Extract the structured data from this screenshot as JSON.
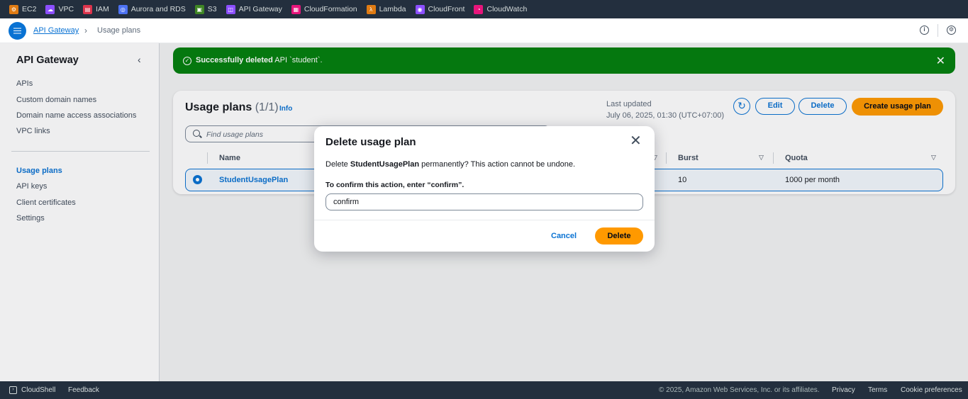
{
  "services": [
    {
      "label": "EC2",
      "icon": "ec2-icon",
      "color": "#e07b13"
    },
    {
      "label": "VPC",
      "icon": "vpc-icon",
      "color": "#8c4fff"
    },
    {
      "label": "IAM",
      "icon": "iam-icon",
      "color": "#dd344c"
    },
    {
      "label": "Aurora and RDS",
      "icon": "rds-icon",
      "color": "#4d72f3"
    },
    {
      "label": "S3",
      "icon": "s3-icon",
      "color": "#3f8624"
    },
    {
      "label": "API Gateway",
      "icon": "api-gateway-icon",
      "color": "#8c4fff"
    },
    {
      "label": "CloudFormation",
      "icon": "cloudformation-icon",
      "color": "#e7157b"
    },
    {
      "label": "Lambda",
      "icon": "lambda-icon",
      "color": "#e07b13"
    },
    {
      "label": "CloudFront",
      "icon": "cloudfront-icon",
      "color": "#8c4fff"
    },
    {
      "label": "CloudWatch",
      "icon": "cloudwatch-icon",
      "color": "#e7157b"
    }
  ],
  "breadcrumb": {
    "root": "API Gateway",
    "current": "Usage plans"
  },
  "sidebar": {
    "title": "API Gateway",
    "items_top": [
      "APIs",
      "Custom domain names",
      "Domain name access associations",
      "VPC links"
    ],
    "items_bottom": [
      "Usage plans",
      "API keys",
      "Client certificates",
      "Settings"
    ],
    "active": "Usage plans"
  },
  "flash": {
    "bold": "Successfully deleted",
    "rest": "API `student`."
  },
  "usage_plans": {
    "title": "Usage plans",
    "count": "(1/1)",
    "info": "Info",
    "last_updated_label": "Last updated",
    "last_updated_value": "July 06, 2025, 01:30 (UTC+07:00)",
    "edit": "Edit",
    "delete": "Delete",
    "create": "Create usage plan",
    "search_placeholder": "Find usage plans",
    "columns": {
      "name": "Name",
      "burst": "Burst",
      "quota": "Quota"
    },
    "row": {
      "name": "StudentUsagePlan",
      "burst": "10",
      "quota": "1000 per month"
    }
  },
  "modal": {
    "title": "Delete usage plan",
    "text_prefix": "Delete",
    "text_name": "StudentUsagePlan",
    "text_suffix": "permanently? This action cannot be undone.",
    "confirm_label": "To confirm this action, enter “confirm”.",
    "confirm_value": "confirm",
    "cancel": "Cancel",
    "delete": "Delete"
  },
  "footer": {
    "cloudshell": "CloudShell",
    "feedback": "Feedback",
    "copyright": "© 2025, Amazon Web Services, Inc. or its affiliates.",
    "privacy": "Privacy",
    "terms": "Terms",
    "cookies": "Cookie preferences"
  }
}
